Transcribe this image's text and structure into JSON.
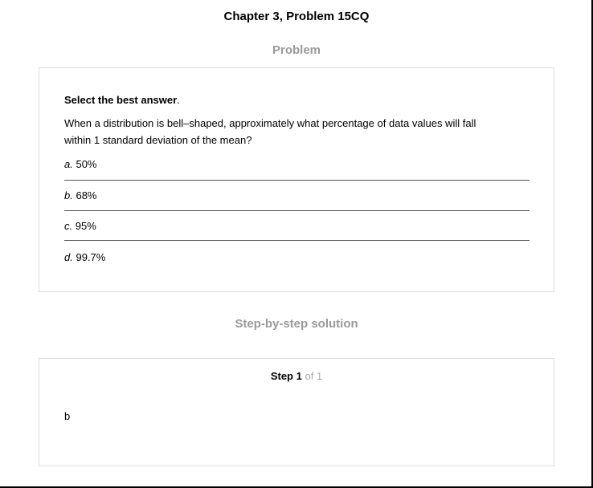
{
  "header": {
    "title": "Chapter 3, Problem 15CQ"
  },
  "problem": {
    "heading": "Problem",
    "instruction": "Select the best answer",
    "instruction_end": ".",
    "question_line1": "When a distribution is bell–shaped, approximately what percentage of data values will fall",
    "question_line2": "within 1 standard deviation of the mean?",
    "options": [
      {
        "letter": "a.",
        "text": "50%"
      },
      {
        "letter": "b.",
        "text": "68%"
      },
      {
        "letter": "c.",
        "text": "95%"
      },
      {
        "letter": "d.",
        "text": "99.7%"
      }
    ]
  },
  "solution": {
    "heading": "Step-by-step solution",
    "step_label": "Step 1",
    "step_total": "of 1",
    "answer": "b"
  }
}
